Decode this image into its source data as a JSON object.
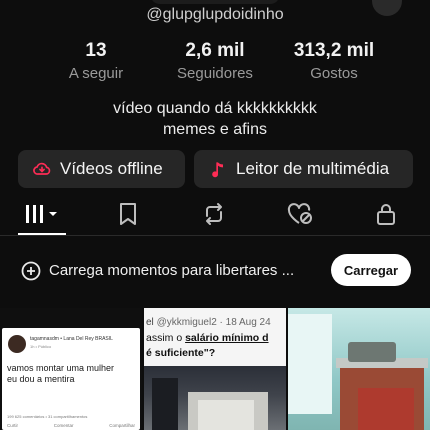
{
  "profile": {
    "username": "@glupglupdoidinho",
    "bio_line1": "vídeo quando dá kkkkkkkkkk",
    "bio_line2": "memes e afins"
  },
  "stats": [
    {
      "value": "13",
      "label": "A seguir"
    },
    {
      "value": "2,6 mil",
      "label": "Seguidores"
    },
    {
      "value": "313,2 mil",
      "label": "Gostos"
    }
  ],
  "actions": {
    "offline_label": "Vídeos offline",
    "player_label": "Leitor de multimédia"
  },
  "tabs": [
    {
      "icon": "grid-icon",
      "active": true
    },
    {
      "icon": "bookmark-icon",
      "active": false
    },
    {
      "icon": "repost-icon",
      "active": false
    },
    {
      "icon": "liked-hidden-icon",
      "active": false
    },
    {
      "icon": "lock-icon",
      "active": false
    }
  ],
  "moments": {
    "text": "Carrega momentos para libertares ...",
    "button_label": "Carregar"
  },
  "thumbnails": {
    "post1": {
      "author": "tagamnasdm • Lana Del Rey BRASIL",
      "time": "1h • Público",
      "text_line1": "vamos montar uma mulher",
      "text_line2": "eu dou a mentira",
      "meta": "199   625 comentários • 31 compartilhamentos",
      "actions": [
        "Curtir",
        "Comentar",
        "Compartilhar"
      ]
    },
    "post2": {
      "handle_prefix": "el",
      "handle": "@ykkmiguel2 · 18 Aug 24",
      "text_line1_pre": "assim o ",
      "text_line1_strong": "salário mínimo d",
      "text_line2": "é suficiente\"?"
    }
  },
  "colors": {
    "background": "#0d0d0d",
    "button_bg": "#262626",
    "accent_red": "#fe2c55",
    "text_muted": "#9a9a9a"
  }
}
